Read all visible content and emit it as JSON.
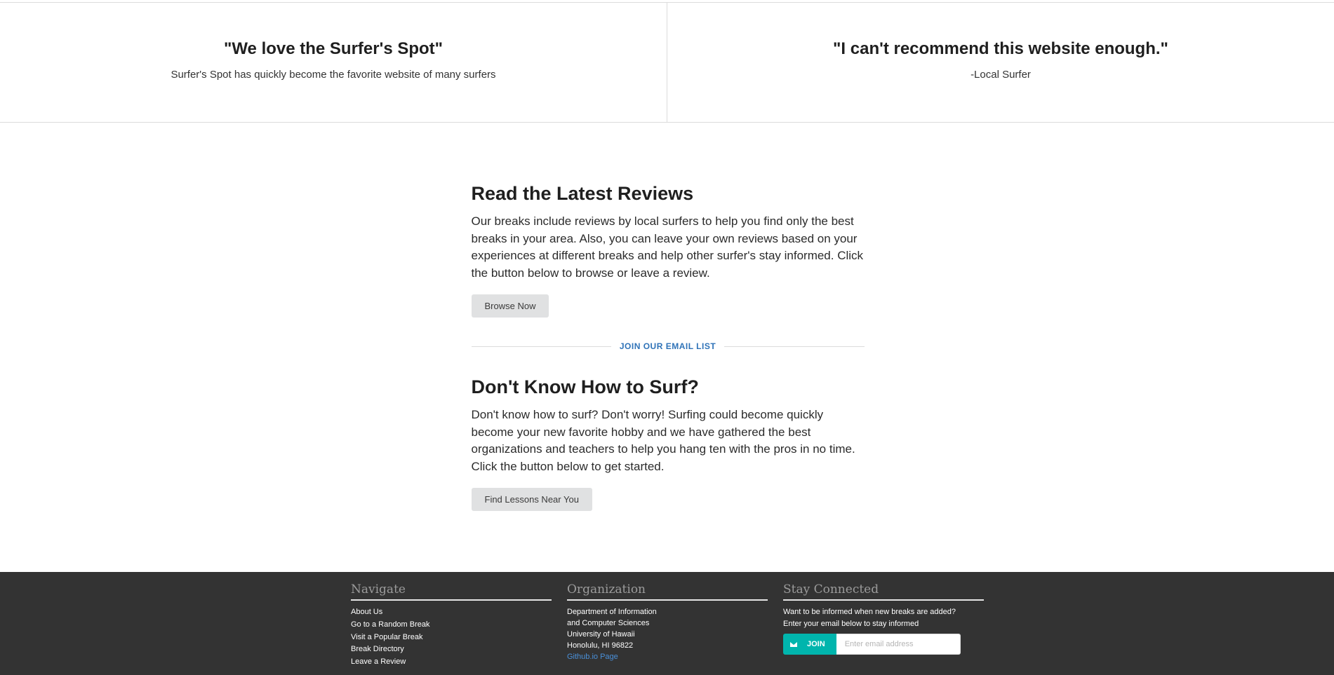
{
  "testimonials": [
    {
      "quote": "\"We love the Surfer's Spot\"",
      "text": "Surfer's Spot has quickly become the favorite website of many surfers"
    },
    {
      "quote": "\"I can't recommend this website enough.\"",
      "text": "-Local Surfer"
    }
  ],
  "reviews": {
    "title": "Read the Latest Reviews",
    "body": "Our breaks include reviews by local surfers to help you find only the best breaks in your area. Also, you can leave your own reviews based on your experiences at different breaks and help other surfer's stay informed. Click the button below to browse or leave a review.",
    "button": "Browse Now"
  },
  "divider": {
    "label": "JOIN OUR EMAIL LIST"
  },
  "lessons": {
    "title": "Don't Know How to Surf?",
    "body": "Don't know how to surf? Don't worry! Surfing could become quickly become your new favorite hobby and we have gathered the best organizations and teachers to help you hang ten with the pros in no time. Click the button below to get started.",
    "button": "Find Lessons Near You"
  },
  "footer": {
    "navigate": {
      "title": "Navigate",
      "links": [
        "About Us",
        "Go to a Random Break",
        "Visit a Popular Break",
        "Break Directory",
        "Leave a Review"
      ]
    },
    "organization": {
      "title": "Organization",
      "lines": [
        "Department of Information",
        "and Computer Sciences",
        "University of Hawaii",
        "Honolulu, HI 96822"
      ],
      "link": "Github.io Page"
    },
    "stay": {
      "title": "Stay Connected",
      "line1": "Want to be informed when new breaks are added?",
      "line2": "Enter your email below to stay informed",
      "join": "JOIN",
      "placeholder": "Enter email address",
      "accent": "#00b5ad"
    }
  }
}
